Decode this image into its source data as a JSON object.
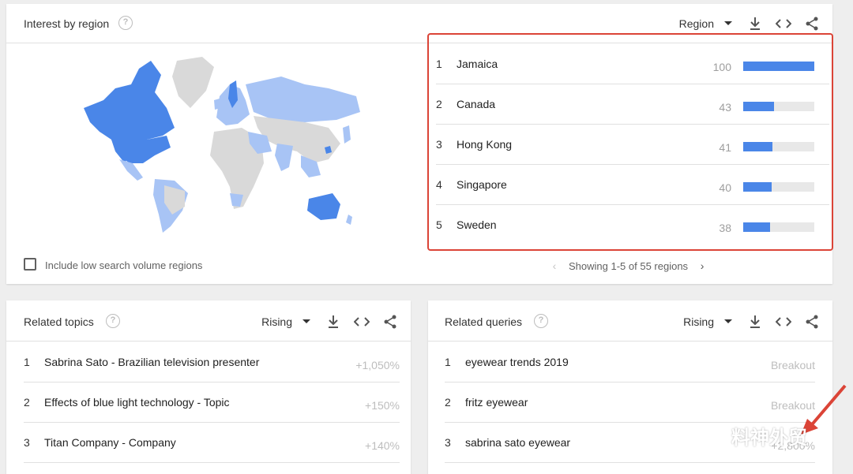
{
  "region_card": {
    "title": "Interest by region",
    "help_icon": "question-circle-icon",
    "dropdown_label": "Region",
    "include_low_volume_label": "Include low search volume regions",
    "pager_text": "Showing 1-5 of 55 regions",
    "rows": [
      {
        "rank": "1",
        "name": "Jamaica",
        "value": "100",
        "fill": 100
      },
      {
        "rank": "2",
        "name": "Canada",
        "value": "43",
        "fill": 43
      },
      {
        "rank": "3",
        "name": "Hong Kong",
        "value": "41",
        "fill": 41
      },
      {
        "rank": "4",
        "name": "Singapore",
        "value": "40",
        "fill": 40
      },
      {
        "rank": "5",
        "name": "Sweden",
        "value": "38",
        "fill": 38
      }
    ]
  },
  "topics_card": {
    "title": "Related topics",
    "dropdown_label": "Rising",
    "rows": [
      {
        "rank": "1",
        "text": "Sabrina Sato - Brazilian television presenter",
        "value": "+1,050%"
      },
      {
        "rank": "2",
        "text": "Effects of blue light technology - Topic",
        "value": "+150%"
      },
      {
        "rank": "3",
        "text": "Titan Company - Company",
        "value": "+140%"
      }
    ]
  },
  "queries_card": {
    "title": "Related queries",
    "dropdown_label": "Rising",
    "rows": [
      {
        "rank": "1",
        "text": "eyewear trends 2019",
        "value": "Breakout"
      },
      {
        "rank": "2",
        "text": "fritz eyewear",
        "value": "Breakout"
      },
      {
        "rank": "3",
        "text": "sabrina sato eyewear",
        "value": "+2,800%"
      }
    ]
  },
  "watermark": {
    "text": "料神外贸"
  },
  "colors": {
    "bar": "#4a86e8",
    "highlight": "#db4437",
    "map_dark": "#4a86e8",
    "map_light": "#a8c4f5",
    "map_none": "#d9d9d9"
  }
}
